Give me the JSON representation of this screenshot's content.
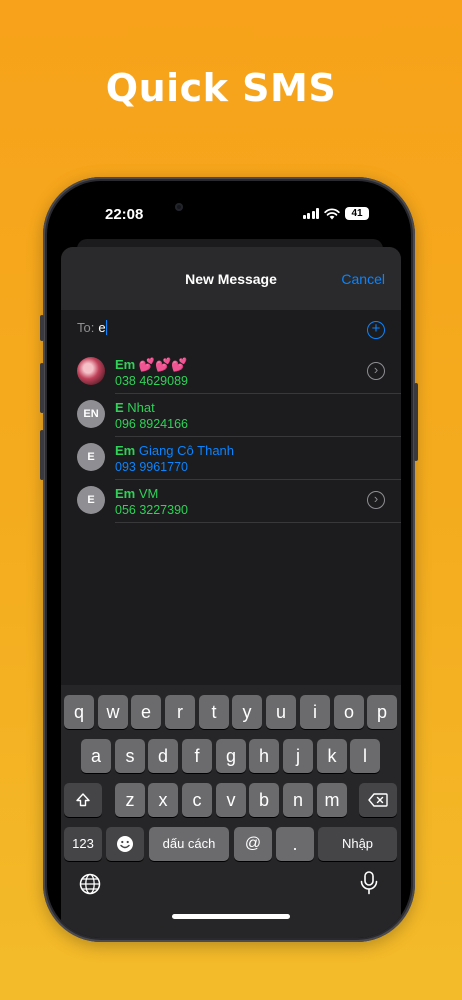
{
  "headline": "Quick SMS",
  "status_bar": {
    "time": "22:08",
    "battery": "41"
  },
  "sheet": {
    "title": "New Message",
    "cancel_label": "Cancel"
  },
  "to_field": {
    "label": "To:",
    "value": "e"
  },
  "contacts": [
    {
      "name_bold": "Em",
      "name_rest": " 💕💕💕",
      "phone": "038 4629089",
      "avatar": "",
      "avatar_type": "photo",
      "name_color": "green",
      "phone_color": "green",
      "has_detail": true
    },
    {
      "name_bold": "E",
      "name_rest": " Nhat",
      "phone": "096 8924166",
      "avatar": "EN",
      "avatar_type": "initials",
      "name_color": "green",
      "phone_color": "green",
      "has_detail": false
    },
    {
      "name_bold": "Em",
      "name_rest": " Giang Cô Thanh",
      "phone": "093 9961770",
      "avatar": "E",
      "avatar_type": "initials",
      "name_color": "blue",
      "phone_color": "blue",
      "has_detail": false
    },
    {
      "name_bold": "Em",
      "name_rest": " VM",
      "phone": "056 3227390",
      "avatar": "E",
      "avatar_type": "initials",
      "name_color": "green",
      "phone_color": "green",
      "has_detail": true
    }
  ],
  "keyboard": {
    "row1": [
      "q",
      "w",
      "e",
      "r",
      "t",
      "y",
      "u",
      "i",
      "o",
      "p"
    ],
    "row2": [
      "a",
      "s",
      "d",
      "f",
      "g",
      "h",
      "j",
      "k",
      "l"
    ],
    "row3": [
      "z",
      "x",
      "c",
      "v",
      "b",
      "n",
      "m"
    ],
    "numbers_label": "123",
    "space_label": "dấu cách",
    "at_label": "@",
    "dot_label": ".",
    "return_label": "Nhập"
  },
  "colors": {
    "accent": "#0a84ff",
    "match_green": "#30d158",
    "background": "#f7a21a"
  }
}
